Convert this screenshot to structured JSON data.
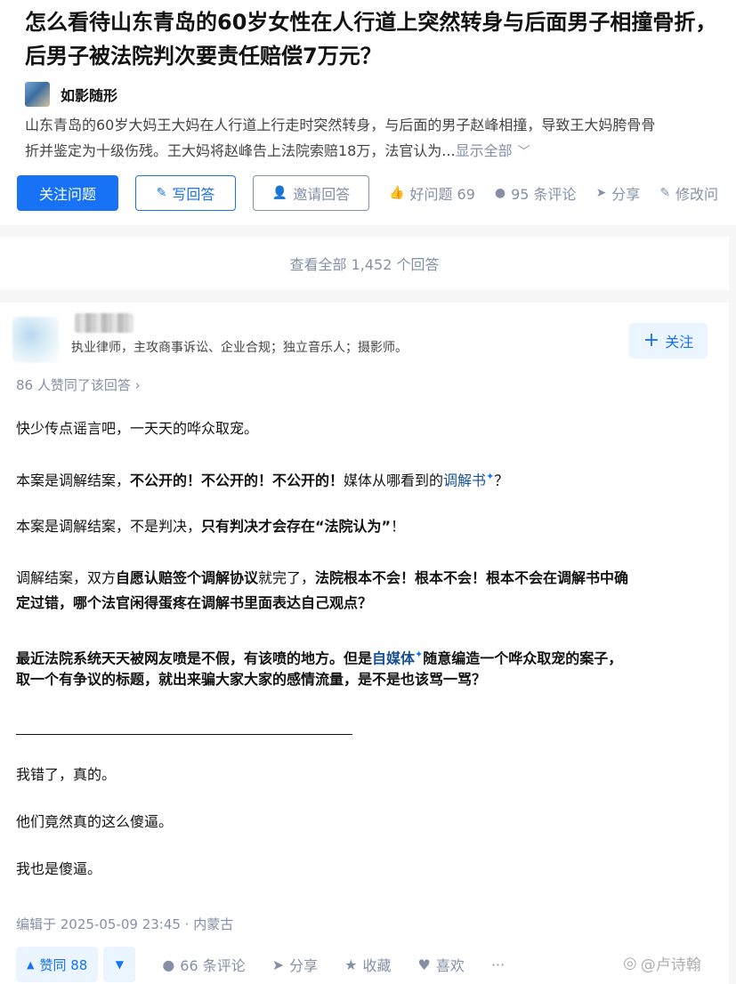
{
  "question": {
    "title": "怎么看待山东青岛的60岁女性在人行道上突然转身与后面男子相撞骨折，后男子被法院判次要责任赔偿7万元？",
    "asker_name": "如影随形",
    "excerpt_line1": "山东青岛的60岁大妈王大妈在人行道上行走时突然转身，与后面的男子赵峰相撞，导致王大妈胯骨骨",
    "excerpt_line2": "折并鉴定为十级伤残。王大妈将赵峰告上法院索赔18万，法官认为...",
    "show_all": "显示全部",
    "buttons": {
      "follow": "关注问题",
      "write": "写回答",
      "invite": "邀请回答",
      "good_question": "好问题 69",
      "comments": "95 条评论",
      "share": "分享",
      "edit": "修改问"
    }
  },
  "view_all_answers": "查看全部 1,452 个回答",
  "answer": {
    "author_bio": "执业律师，主攻商事诉讼、企业合规；独立音乐人；摄影师。",
    "follow_label": "关注",
    "upvote_summary": "86 人赞同了该回答",
    "p1": "快少传点谣言吧，一天天的哗众取宠。",
    "p2": {
      "a": "本案是调解结案，",
      "b": "不公开的！不公开的！不公开的！",
      "c": "媒体从哪看到的",
      "link": "调解书",
      "d": "？"
    },
    "p3": {
      "a": "本案是调解结案，不是判决，",
      "b": "只有判决才会存在“法院认为”",
      "c": "！"
    },
    "p4": {
      "a": "调解结案，双方",
      "b": "自愿认赔签个调解协议",
      "c": "就完了，",
      "d": "法院根本不会！根本不会！根本不会在调解书中确",
      "line2": "定过错，哪个法官闲得蛋疼在调解书里面表达自己观点？"
    },
    "p5": {
      "a": "最近法院系统天天被网友喷是不假，有该喷的地方。但是",
      "link": "自媒体",
      "b": "随意编造一个哗众取宠的案子，",
      "line2": "取一个有争议的标题，就出来骗大家大家的感情流量，是不是也该骂一骂？"
    },
    "p6": "我错了，真的。",
    "p7": "他们竟然真的这么傻逼。",
    "p8": "我也是傻逼。",
    "edit_time": "编辑于 2025-05-09 23:45 · 内蒙古",
    "actions": {
      "upvote": "赞同 88",
      "comments": "66 条评论",
      "share": "分享",
      "collect": "收藏",
      "like": "喜欢",
      "more": "···"
    }
  },
  "watermark": "@卢诗翰",
  "colors": {
    "brand_blue": "#1772f6",
    "light_blue": "#ebf5ff",
    "grey_text": "#8590a6",
    "link": "#175199"
  },
  "icons": [
    "pencil-icon",
    "invite-user-icon",
    "thumb-up-icon",
    "comment-icon",
    "share-icon",
    "plus-icon",
    "triangle-up-icon",
    "triangle-down-icon",
    "star-icon",
    "heart-icon",
    "weibo-icon"
  ]
}
